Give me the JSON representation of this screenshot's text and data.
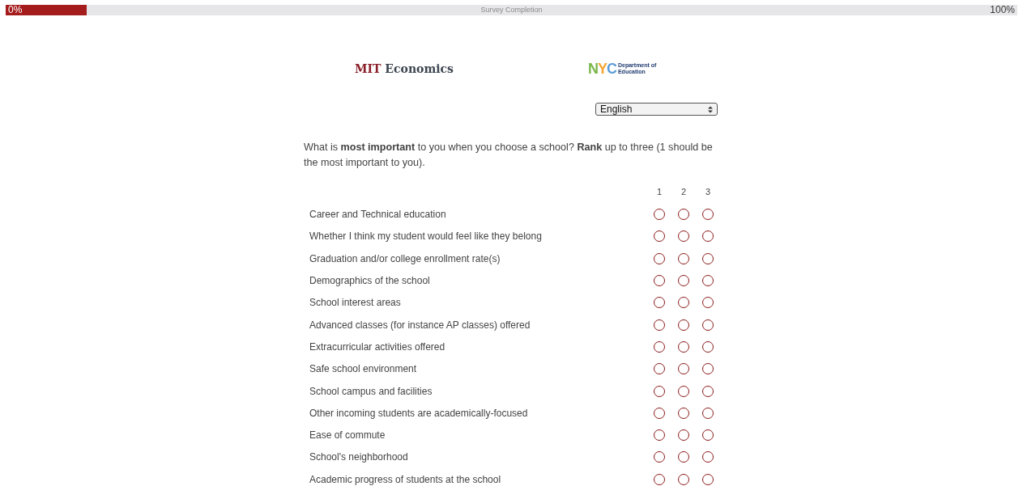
{
  "progress": {
    "start_label": "0%",
    "title": "Survey Completion",
    "end_label": "100%",
    "level": 0.08
  },
  "logos": {
    "mit": {
      "prefix": "MIT",
      "name": "Economics"
    },
    "nyc": {
      "letters": [
        {
          "text": "N",
          "color": "#7ab648"
        },
        {
          "text": "Y",
          "color": "#f7a531"
        },
        {
          "text": "C",
          "color": "#5b9bd5"
        }
      ],
      "line_1": "Department of",
      "line_2": "Education"
    }
  },
  "language": {
    "value": "English"
  },
  "question": "What is **most important** to you when you choose a school? **Rank** up to three (1 should be the most important to you).",
  "rank_columns": [
    "1",
    "2",
    "3"
  ],
  "options": [
    {
      "label": "Career and Technical education",
      "ranks": [
        false,
        false,
        false
      ]
    },
    {
      "label": "Whether I think my student would feel like they belong",
      "ranks": [
        false,
        false,
        false
      ]
    },
    {
      "label": "Graduation and/or college enrollment rate(s)",
      "ranks": [
        false,
        false,
        false
      ]
    },
    {
      "label": "Demographics of the school",
      "ranks": [
        false,
        false,
        false
      ]
    },
    {
      "label": "School interest areas",
      "ranks": [
        false,
        false,
        false
      ]
    },
    {
      "label": "Advanced classes (for instance AP classes) offered",
      "ranks": [
        false,
        false,
        false
      ]
    },
    {
      "label": "Extracurricular activities offered",
      "ranks": [
        false,
        false,
        false
      ]
    },
    {
      "label": "Safe school environment",
      "ranks": [
        false,
        false,
        false
      ]
    },
    {
      "label": "School campus and facilities",
      "ranks": [
        false,
        false,
        false
      ]
    },
    {
      "label": "Other incoming students are academically-focused",
      "ranks": [
        false,
        false,
        false
      ]
    },
    {
      "label": "Ease of commute",
      "ranks": [
        false,
        false,
        false
      ]
    },
    {
      "label": "School's neighborhood",
      "ranks": [
        false,
        false,
        false
      ]
    },
    {
      "label": "Academic progress of students at the school",
      "ranks": [
        false,
        false,
        false
      ]
    }
  ]
}
